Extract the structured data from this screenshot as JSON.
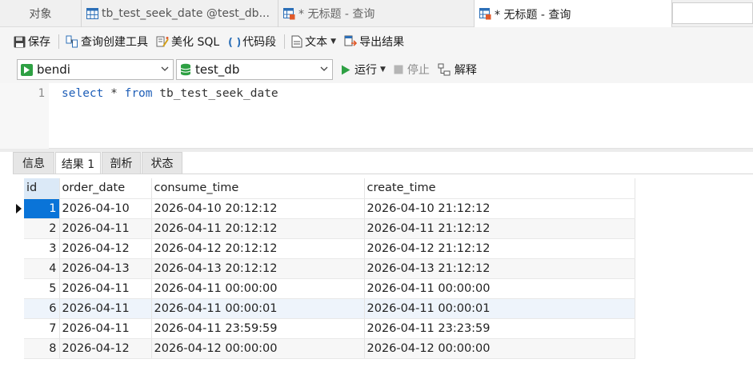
{
  "tabs": [
    {
      "label": "对象"
    },
    {
      "label": "tb_test_seek_date @test_db..."
    },
    {
      "label": "* 无标题 - 查询"
    },
    {
      "label": "* 无标题 - 查询"
    }
  ],
  "toolbar": {
    "save": "保存",
    "query_builder": "查询创建工具",
    "beautify": "美化 SQL",
    "snippet": "代码段",
    "text": "文本",
    "export": "导出结果"
  },
  "connection": {
    "conn_name": "bendi",
    "db_name": "test_db",
    "run": "运行",
    "stop": "停止",
    "explain": "解释"
  },
  "editor": {
    "line_number": "1",
    "kw_select": "select",
    "star": " * ",
    "kw_from": "from",
    "table": " tb_test_seek_date"
  },
  "result_tabs": {
    "info": "信息",
    "result": "结果 1",
    "profile": "剖析",
    "status": "状态"
  },
  "grid": {
    "columns": [
      "id",
      "order_date",
      "consume_time",
      "create_time"
    ],
    "rows": [
      [
        "1",
        "2026-04-10",
        "2026-04-10 20:12:12",
        "2026-04-10 21:12:12"
      ],
      [
        "2",
        "2026-04-11",
        "2026-04-11 20:12:12",
        "2026-04-11 21:12:12"
      ],
      [
        "3",
        "2026-04-12",
        "2026-04-12 20:12:12",
        "2026-04-12 21:12:12"
      ],
      [
        "4",
        "2026-04-13",
        "2026-04-13 20:12:12",
        "2026-04-13 21:12:12"
      ],
      [
        "5",
        "2026-04-11",
        "2026-04-11 00:00:00",
        "2026-04-11 00:00:00"
      ],
      [
        "6",
        "2026-04-11",
        "2026-04-11 00:00:01",
        "2026-04-11 00:00:01"
      ],
      [
        "7",
        "2026-04-11",
        "2026-04-11 23:59:59",
        "2026-04-11 23:23:59"
      ],
      [
        "8",
        "2026-04-12",
        "2026-04-12 00:00:00",
        "2026-04-12 00:00:00"
      ]
    ]
  },
  "icons": {
    "save": "floppy-icon",
    "query_builder": "query-builder-icon",
    "beautify": "beautify-icon",
    "snippet": "braces-icon",
    "text": "document-icon",
    "export": "export-icon",
    "run": "play-icon",
    "stop": "stop-icon",
    "explain": "explain-icon"
  },
  "colors": {
    "selection": "#0a74d8",
    "keyword": "#1f5fb8",
    "run_green": "#2ea043"
  }
}
